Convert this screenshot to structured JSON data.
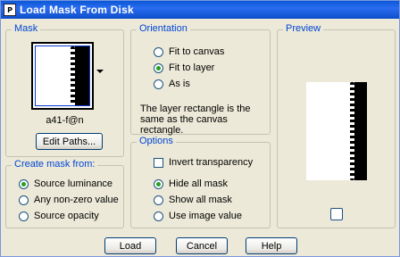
{
  "window": {
    "title": "Load Mask From Disk",
    "icon": "app-icon"
  },
  "mask": {
    "legend": "Mask",
    "filename": "a41-f@n",
    "edit_paths_label": "Edit Paths...",
    "dropdown_icon": "triangle-down"
  },
  "create_from": {
    "legend": "Create mask from:",
    "options": [
      {
        "label": "Source luminance",
        "selected": true
      },
      {
        "label": "Any non-zero value",
        "selected": false
      },
      {
        "label": "Source opacity",
        "selected": false
      }
    ]
  },
  "orientation": {
    "legend": "Orientation",
    "options": [
      {
        "label": "Fit to canvas",
        "selected": false
      },
      {
        "label": "Fit to layer",
        "selected": true
      },
      {
        "label": "As is",
        "selected": false
      }
    ],
    "note": "The layer rectangle is the same as the canvas rectangle."
  },
  "options": {
    "legend": "Options",
    "invert_label": "Invert transparency",
    "invert_checked": false,
    "choices": [
      {
        "label": "Hide all mask",
        "selected": true
      },
      {
        "label": "Show all mask",
        "selected": false
      },
      {
        "label": "Use image value",
        "selected": false
      }
    ]
  },
  "preview": {
    "legend": "Preview"
  },
  "buttons": {
    "load": "Load",
    "cancel": "Cancel",
    "help": "Help"
  },
  "colors": {
    "titlebar": "#0a58d6",
    "legend": "#0046d5",
    "radio_selected": "#21a121"
  }
}
